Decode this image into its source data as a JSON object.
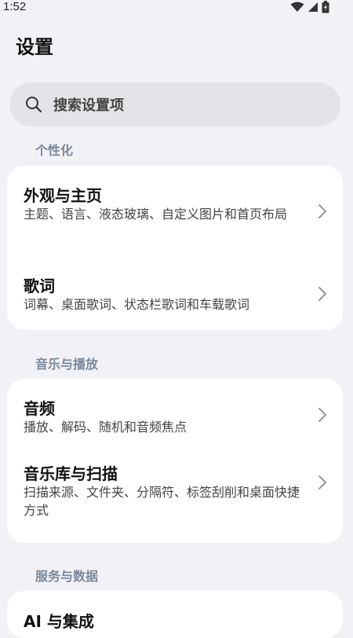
{
  "status_bar": {
    "time": "1:52",
    "icons": [
      "wifi-icon",
      "signal-icon",
      "battery-charging-icon"
    ]
  },
  "header": {
    "title": "设置"
  },
  "search": {
    "placeholder": "搜索设置项",
    "icon": "search-icon"
  },
  "sections": [
    {
      "label": "个性化",
      "items": [
        {
          "title": "外观与主页",
          "subtitle": "主题、语言、液态玻璃、自定义图片和首页布局"
        },
        {
          "title": "歌词",
          "subtitle": "词幕、桌面歌词、状态栏歌词和车载歌词"
        }
      ]
    },
    {
      "label": "音乐与播放",
      "items": [
        {
          "title": "音频",
          "subtitle": "播放、解码、随机和音频焦点"
        },
        {
          "title": "音乐库与扫描",
          "subtitle": "扫描来源、文件夹、分隔符、标签刮削和桌面快捷方式"
        }
      ]
    },
    {
      "label": "服务与数据",
      "items": [
        {
          "title": "AI 与集成",
          "subtitle": ""
        }
      ]
    }
  ],
  "colors": {
    "background": "#f2f2f6",
    "card": "#ffffff",
    "search_bg": "#e4e4e8",
    "section_label": "#7a879c",
    "chevron": "#8a8a8f"
  }
}
